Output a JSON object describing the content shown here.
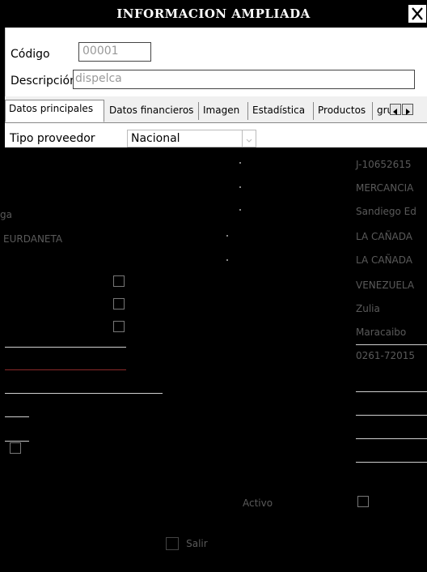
{
  "window": {
    "title": "INFORMACION AMPLIADA"
  },
  "form": {
    "codigo_label": "Código",
    "codigo_value": "00001",
    "descripcion_label": "Descripción",
    "descripcion_value": "dispelca"
  },
  "tabs": [
    {
      "label": "Datos principales",
      "active": true
    },
    {
      "label": "Datos financieros"
    },
    {
      "label": "Imagen"
    },
    {
      "label": "Estadística"
    },
    {
      "label": "Productos"
    },
    {
      "label": "gru"
    }
  ],
  "tipo": {
    "label": "Tipo proveedor",
    "value": "Nacional"
  },
  "ghost_left": [
    "ga",
    "EURDANETA"
  ],
  "ghost_right": [
    "J-10652615",
    "MERCANCIA",
    "Sandiego Ed",
    "LA CAÑADA",
    "LA CAÑADA",
    "VENEZUELA",
    "Zulia",
    "Maracaibo",
    "0261-72015"
  ],
  "activo_label": "Activo",
  "salir_label": "Salir"
}
